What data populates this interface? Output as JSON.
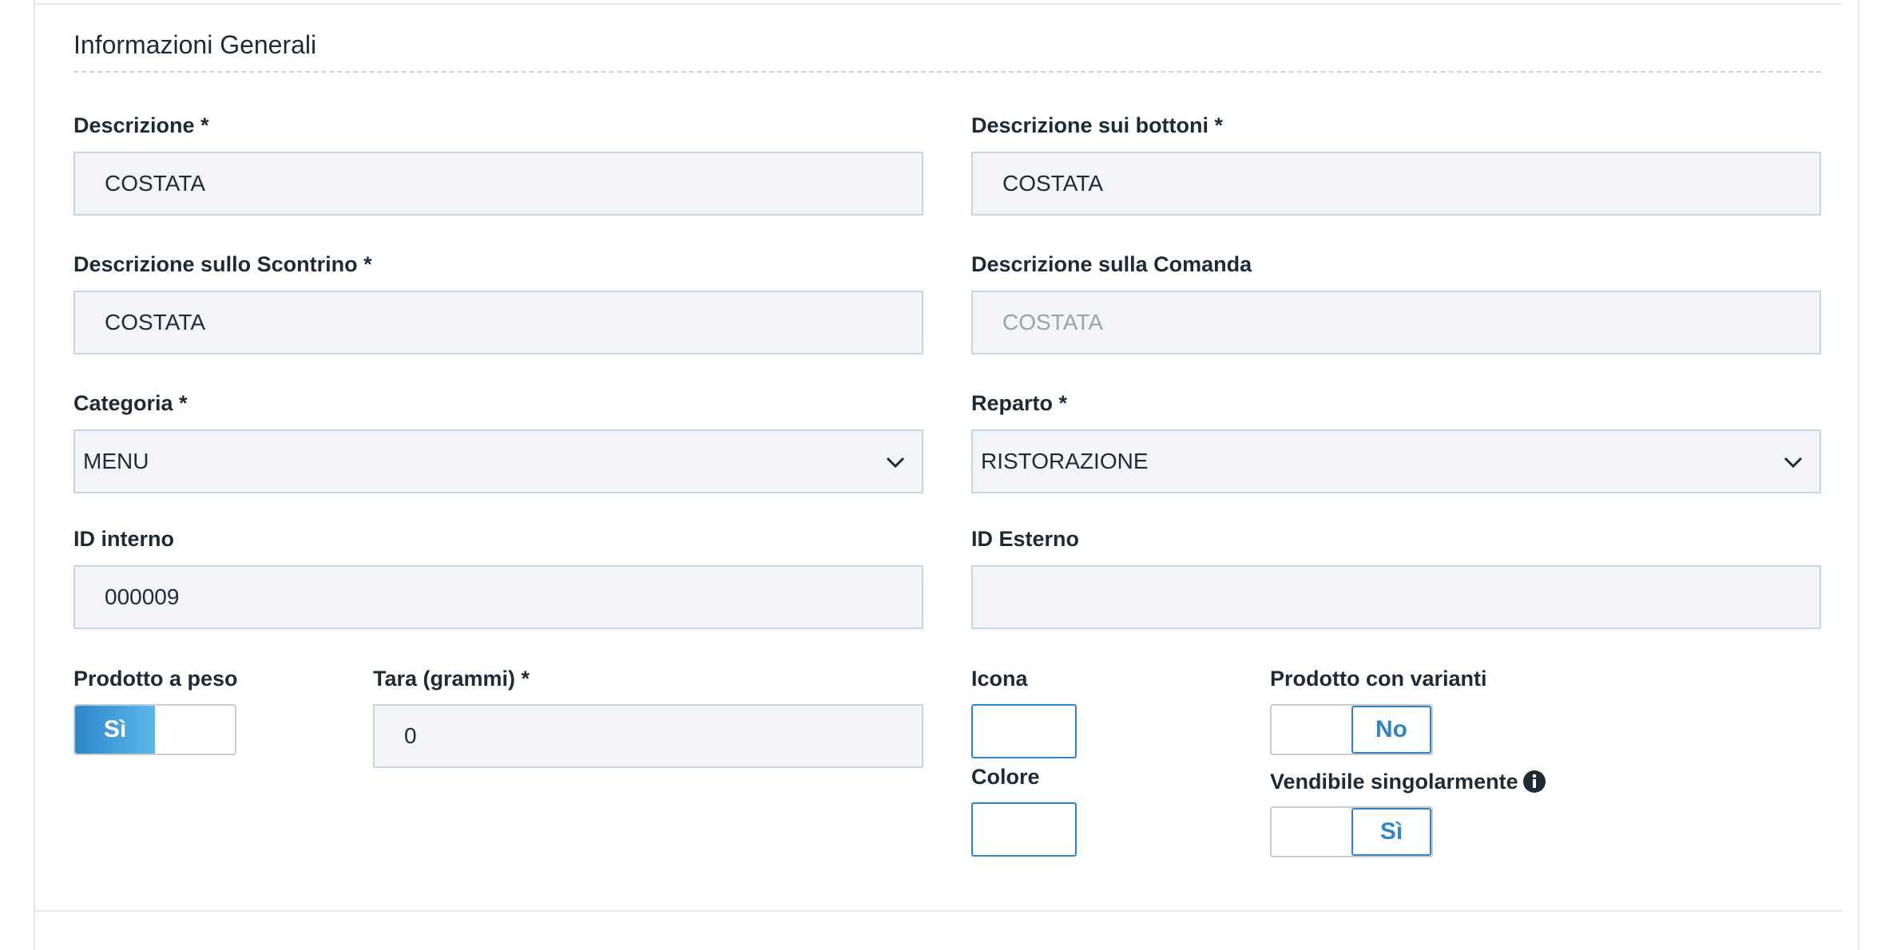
{
  "section": {
    "title": "Informazioni Generali"
  },
  "fields": {
    "descrizione": {
      "label": "Descrizione *",
      "value": "COSTATA"
    },
    "descrizione_bottoni": {
      "label": "Descrizione sui bottoni *",
      "value": "COSTATA"
    },
    "descrizione_scontrino": {
      "label": "Descrizione sullo Scontrino *",
      "value": "COSTATA"
    },
    "descrizione_comanda": {
      "label": "Descrizione sulla Comanda",
      "placeholder": "COSTATA"
    },
    "categoria": {
      "label": "Categoria *",
      "value": "MENU"
    },
    "reparto": {
      "label": "Reparto *",
      "value": "RISTORAZIONE"
    },
    "id_interno": {
      "label": "ID interno",
      "value": "000009"
    },
    "id_esterno": {
      "label": "ID Esterno",
      "value": ""
    },
    "prodotto_peso": {
      "label": "Prodotto a peso",
      "state": "Sì"
    },
    "tara": {
      "label": "Tara (grammi) *",
      "value": "0"
    },
    "icona": {
      "label": "Icona"
    },
    "colore": {
      "label": "Colore"
    },
    "prodotto_varianti": {
      "label": "Prodotto con varianti",
      "state": "No"
    },
    "vendibile": {
      "label": "Vendibile singolarmente",
      "state": "Sì"
    }
  },
  "icons": {
    "select_arrow": "chevron-down-icon",
    "info": "info-icon"
  },
  "colors": {
    "accent": "#2e86c9",
    "field_bg": "#f2f4f7",
    "field_border": "#c8d6e3"
  }
}
